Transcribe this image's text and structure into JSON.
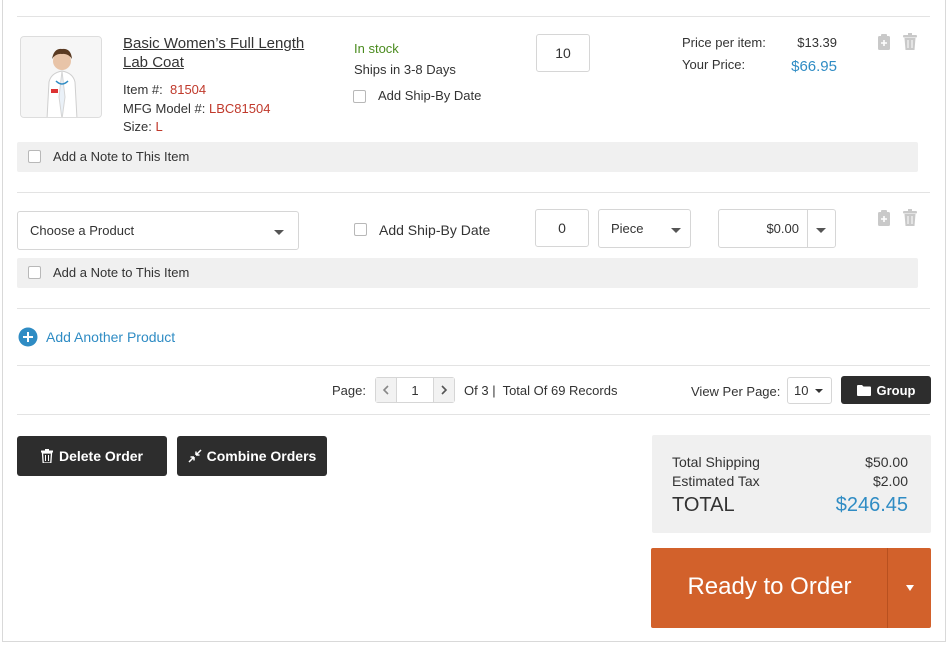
{
  "item": {
    "title": "Basic Women’s Full Length Lab Coat",
    "item_label": "Item #:",
    "item_number": "81504",
    "model_label": "MFG Model #:",
    "model_number": "LBC81504",
    "size_label": "Size:",
    "size_value": "L",
    "stock_status": "In stock",
    "ships_text": "Ships in 3-8 Days",
    "ship_by_label": "Add Ship-By Date",
    "quantity": "10",
    "price_per_item_label": "Price per item:",
    "price_per_item": "$13.39",
    "your_price_label": "Your Price:",
    "your_price": "$66.95",
    "note_label": "Add a Note to This Item"
  },
  "new_item": {
    "product_placeholder": "Choose a Product",
    "ship_by_label": "Add Ship-By Date",
    "quantity": "0",
    "unit": "Piece",
    "price": "$0.00",
    "note_label": "Add a Note to This Item"
  },
  "add_product_label": "Add Another Product",
  "pagination": {
    "page_label": "Page:",
    "current_page": "1",
    "of_text": "Of 3",
    "total_text": "Total Of 69 Records",
    "view_per_page_label": "View Per Page:",
    "per_page": "10",
    "group_label": "Group"
  },
  "actions": {
    "delete_label": "Delete Order",
    "combine_label": "Combine Orders"
  },
  "summary": {
    "shipping_label": "Total Shipping",
    "shipping_value": "$50.00",
    "tax_label": "Estimated Tax",
    "tax_value": "$2.00",
    "total_label": "TOTAL",
    "total_value": "$246.45"
  },
  "ready_label": "Ready to Order",
  "colors": {
    "accent_blue": "#2f8cc4",
    "order_button": "#d2612b",
    "dark_button": "#2d2d2d",
    "stock_green": "#4a8b1e",
    "detail_red": "#c0392b"
  }
}
